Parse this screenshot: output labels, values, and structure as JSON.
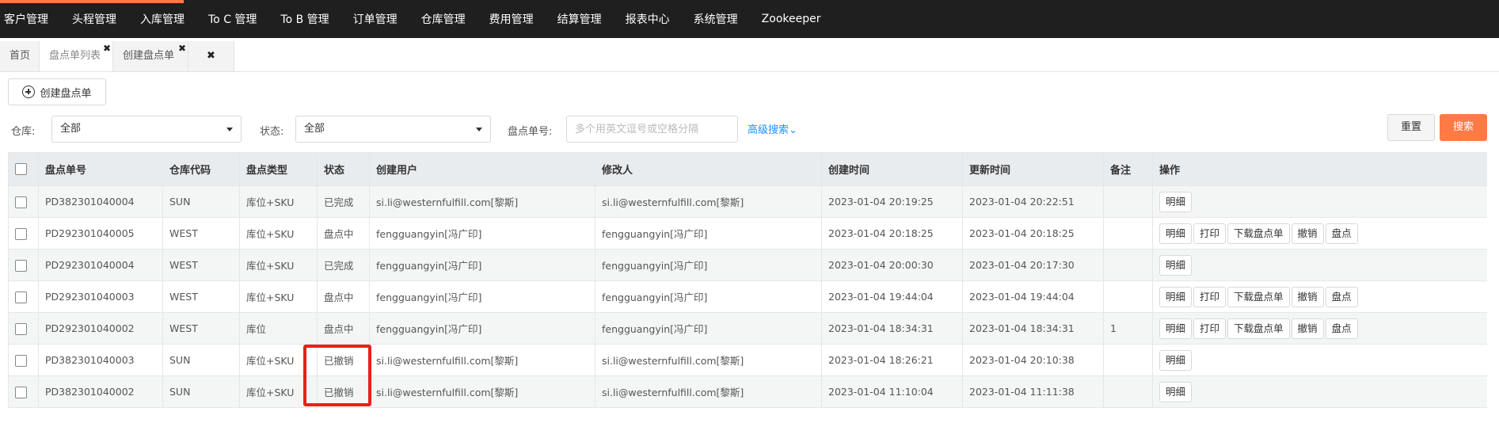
{
  "nav": {
    "items": [
      "客户管理",
      "头程管理",
      "入库管理",
      "To C 管理",
      "To B 管理",
      "订单管理",
      "仓库管理",
      "费用管理",
      "结算管理",
      "报表中心",
      "系统管理",
      "Zookeeper"
    ],
    "accent_color": "#ff7a3d"
  },
  "tabs": {
    "home": "首页",
    "list": "盘点单列表",
    "create": "创建盘点单",
    "close_all": "✖"
  },
  "toolbar": {
    "create_label": "创建盘点单"
  },
  "filters": {
    "warehouse_label": "仓库:",
    "warehouse_value": "全部",
    "status_label": "状态:",
    "status_value": "全部",
    "order_no_label": "盘点单号:",
    "order_no_placeholder": "多个用英文逗号或空格分隔",
    "advanced_search": "高级搜索",
    "reset": "重置",
    "search": "搜索"
  },
  "table": {
    "columns": [
      "盘点单号",
      "仓库代码",
      "盘点类型",
      "状态",
      "创建用户",
      "修改人",
      "创建时间",
      "更新时间",
      "备注",
      "操作"
    ],
    "rows": [
      {
        "no": "PD382301040004",
        "wh": "SUN",
        "type": "库位+SKU",
        "status": "已完成",
        "creator": "si.li@westernfulfill.com[黎斯]",
        "modifier": "si.li@westernfulfill.com[黎斯]",
        "created": "2023-01-04 20:19:25",
        "updated": "2023-01-04 20:22:51",
        "remark": ""
      },
      {
        "no": "PD292301040005",
        "wh": "WEST",
        "type": "库位+SKU",
        "status": "盘点中",
        "creator": "fengguangyin[冯广印]",
        "modifier": "fengguangyin[冯广印]",
        "created": "2023-01-04 20:18:25",
        "updated": "2023-01-04 20:18:25",
        "remark": ""
      },
      {
        "no": "PD292301040004",
        "wh": "WEST",
        "type": "库位+SKU",
        "status": "已完成",
        "creator": "fengguangyin[冯广印]",
        "modifier": "fengguangyin[冯广印]",
        "created": "2023-01-04 20:00:30",
        "updated": "2023-01-04 20:17:30",
        "remark": ""
      },
      {
        "no": "PD292301040003",
        "wh": "WEST",
        "type": "库位+SKU",
        "status": "盘点中",
        "creator": "fengguangyin[冯广印]",
        "modifier": "fengguangyin[冯广印]",
        "created": "2023-01-04 19:44:04",
        "updated": "2023-01-04 19:44:04",
        "remark": ""
      },
      {
        "no": "PD292301040002",
        "wh": "WEST",
        "type": "库位",
        "status": "盘点中",
        "creator": "fengguangyin[冯广印]",
        "modifier": "fengguangyin[冯广印]",
        "created": "2023-01-04 18:34:31",
        "updated": "2023-01-04 18:34:31",
        "remark": "1"
      },
      {
        "no": "PD382301040003",
        "wh": "SUN",
        "type": "库位+SKU",
        "status": "已撤销",
        "creator": "si.li@westernfulfill.com[黎斯]",
        "modifier": "si.li@westernfulfill.com[黎斯]",
        "created": "2023-01-04 18:26:21",
        "updated": "2023-01-04 20:10:38",
        "remark": ""
      },
      {
        "no": "PD382301040002",
        "wh": "SUN",
        "type": "库位+SKU",
        "status": "已撤销",
        "creator": "si.li@westernfulfill.com[黎斯]",
        "modifier": "si.li@westernfulfill.com[黎斯]",
        "created": "2023-01-04 11:10:04",
        "updated": "2023-01-04 11:11:38",
        "remark": ""
      }
    ],
    "actions": {
      "detail": "明细",
      "print": "打印",
      "download": "下载盘点单",
      "cancel": "撤销",
      "count": "盘点"
    }
  },
  "highlight_color": "#e8201b"
}
